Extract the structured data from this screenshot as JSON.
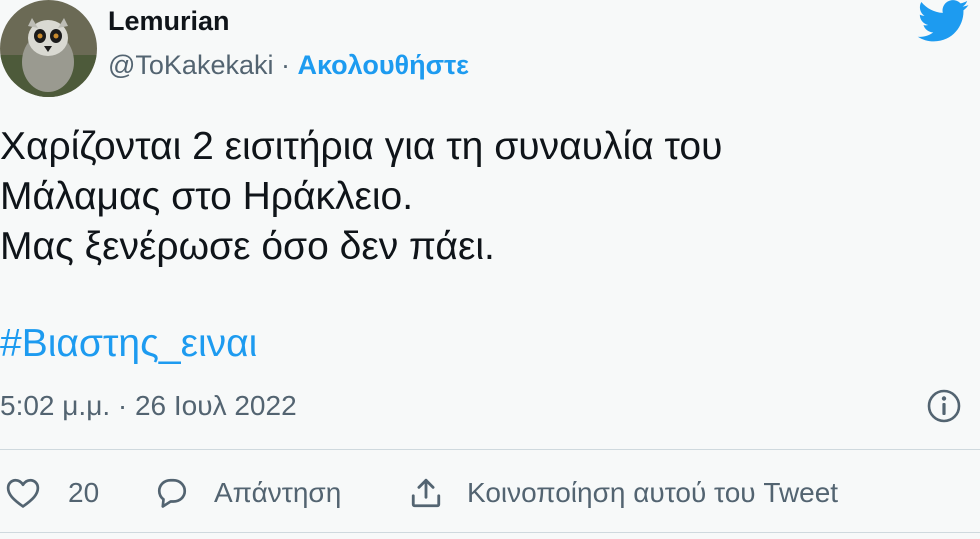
{
  "tweet": {
    "author_name": "Lemurian",
    "handle": "@ToKakekaki",
    "separator": " · ",
    "follow_label": "Ακολουθήστε",
    "text_lines": [
      "Χαρίζονται 2 εισιτήρια για τη συναυλία του",
      "Μάλαμας στο Ηράκλειο.",
      "Μας ξενέρωσε όσο δεν πάει."
    ],
    "hashtag": "#Βιαστης_ειναι",
    "timestamp": "5:02 μ.μ. · 26 Ιουλ 2022"
  },
  "actions": {
    "like_count": "20",
    "reply_label": "Απάντηση",
    "share_label": "Κοινοποίηση αυτού του Tweet"
  },
  "icons": {
    "brand": "twitter-bird-icon",
    "info": "info-icon",
    "like": "heart-icon",
    "reply": "speech-bubble-icon",
    "share": "share-upload-icon"
  },
  "colors": {
    "accent": "#1d9bf0",
    "text": "#0f1419",
    "muted": "#536471",
    "background": "#f7f9f9"
  }
}
